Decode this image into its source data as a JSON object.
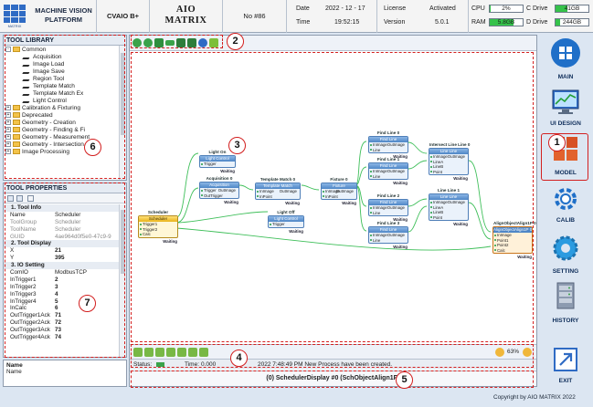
{
  "header": {
    "logo_text": "MATRIX",
    "platform": [
      "MACHINE VISION",
      "PLATFORM"
    ],
    "device": "CVAIO B+",
    "brand": [
      "AIO",
      "MATRIX"
    ],
    "number": "No #86",
    "date_label": "Date",
    "date_value": "2022 - 12 - 17",
    "time_label": "Time",
    "time_value": "19:52:15",
    "license_label": "License",
    "license_value": "Activated",
    "version_label": "Version",
    "version_value": "5.0.1",
    "cpu_label": "CPU",
    "cpu_value": "2%",
    "cpu_fraction": 0.02,
    "ram_label": "RAM",
    "ram_value": "5.8GB",
    "ram_fraction": 0.72,
    "c_drive_label": "C Drive",
    "c_drive_value": "41GB",
    "c_drive_fraction": 0.35,
    "d_drive_label": "D Drive",
    "d_drive_value": "244GB",
    "d_drive_fraction": 0.15
  },
  "tool_library": {
    "title": "TOOL LIBRARY",
    "items": [
      {
        "label": "Common",
        "type": "folder",
        "expanded": true,
        "level": 0
      },
      {
        "label": "Acquisition",
        "type": "tool",
        "level": 1
      },
      {
        "label": "Image Load",
        "type": "tool",
        "level": 1
      },
      {
        "label": "Image Save",
        "type": "tool",
        "level": 1
      },
      {
        "label": "Region Tool",
        "type": "tool",
        "level": 1
      },
      {
        "label": "Template Match",
        "type": "tool",
        "level": 1
      },
      {
        "label": "Template Match Ex",
        "type": "tool",
        "level": 1
      },
      {
        "label": "Light Control",
        "type": "tool",
        "level": 1
      },
      {
        "label": "Calibration & Fixturing",
        "type": "folder",
        "level": 0
      },
      {
        "label": "Deprecated",
        "type": "folder",
        "level": 0
      },
      {
        "label": "Geometry - Creation",
        "type": "folder",
        "level": 0
      },
      {
        "label": "Geometry - Finding & Fi",
        "type": "folder",
        "level": 0
      },
      {
        "label": "Geometry - Measurement",
        "type": "folder",
        "level": 0
      },
      {
        "label": "Geometry - Intersection",
        "type": "folder",
        "level": 0
      },
      {
        "label": "Image Processing",
        "type": "folder",
        "level": 0
      }
    ]
  },
  "tool_properties": {
    "title": "TOOL PROPERTIES",
    "rows": [
      {
        "cat": true,
        "k": "1. Tool Info"
      },
      {
        "k": "Name",
        "v": "Scheduler"
      },
      {
        "k": "ToolGroup",
        "v": "Scheduler",
        "dim": true
      },
      {
        "k": "ToolName",
        "v": "Scheduler",
        "dim": true
      },
      {
        "k": "GUID",
        "v": "4ae964d0f5e0-47c9-9",
        "dim": true
      },
      {
        "cat": true,
        "k": "2. Tool Display"
      },
      {
        "k": "X",
        "v": "21",
        "bold": true
      },
      {
        "k": "Y",
        "v": "395",
        "bold": true
      },
      {
        "cat": true,
        "k": "3. IO Setting"
      },
      {
        "k": "ComIO",
        "v": "ModbusTCP"
      },
      {
        "k": "InTrigger1",
        "v": "2",
        "bold": true
      },
      {
        "k": "InTrigger2",
        "v": "3",
        "bold": true
      },
      {
        "k": "InTrigger3",
        "v": "4",
        "bold": true
      },
      {
        "k": "InTrigger4",
        "v": "5",
        "bold": true
      },
      {
        "k": "InCalc",
        "v": "6",
        "bold": true
      },
      {
        "k": "OutTrigger1Ack",
        "v": "71",
        "bold": true
      },
      {
        "k": "OutTrigger2Ack",
        "v": "72",
        "bold": true
      },
      {
        "k": "OutTrigger3Ack",
        "v": "73",
        "bold": true
      },
      {
        "k": "OutTrigger4Ack",
        "v": "74",
        "bold": true
      }
    ],
    "desc_title": "Name",
    "desc_text": "Name"
  },
  "canvas": {
    "status_label": "Status:",
    "time_label": "Time:",
    "time_value": "0.000",
    "message": "2022 7:48:49 PM New Process have been created.",
    "zoom": "63%",
    "display_bar": "(0) SchedulerDisplay #0 (SchObjectAlign1P)"
  },
  "nodes": {
    "scheduler": {
      "title": "Scheduler",
      "bar": "Scheduler",
      "rows": [
        "Trigger1",
        "Trigger2",
        "Calc"
      ],
      "status": "Waiting"
    },
    "light_on": {
      "title": "Light On",
      "bar": "Light Control",
      "rows": [
        "Trigger"
      ],
      "status": "Waiting"
    },
    "acq": {
      "title": "Acquisition 0",
      "bar": "Acquisition",
      "rows": [
        "Trigger|OutImage",
        "OutTrigger"
      ],
      "status": "Waiting"
    },
    "tmatch": {
      "title": "Template Match 0",
      "bar": "Template Match",
      "rows": [
        "InImage|OutImage",
        "InPoint"
      ],
      "status": "Waiting"
    },
    "fixture": {
      "title": "Fixture 0",
      "bar": "Fixture",
      "rows": [
        "InImage|OutImage",
        "InPoint"
      ],
      "status": "Waiting"
    },
    "light_off": {
      "title": "Light Off",
      "bar": "Light Control",
      "rows": [
        "Trigger"
      ],
      "status": "Waiting"
    },
    "fl0": {
      "title": "Find Line 0",
      "bar": "Find Line",
      "rows": [
        "InImage|OutImage",
        "Line"
      ],
      "status": "Waiting"
    },
    "fl1": {
      "title": "Find Line 1",
      "bar": "Find Line",
      "rows": [
        "InImage|OutImage",
        "Line"
      ],
      "status": "Waiting"
    },
    "fl2": {
      "title": "Find Line 2",
      "bar": "Find Line",
      "rows": [
        "InImage|OutImage",
        "Line"
      ],
      "status": "Waiting"
    },
    "fl3": {
      "title": "Find Line 3",
      "bar": "Find Line",
      "rows": [
        "InImage|OutImage",
        "Line"
      ],
      "status": "Waiting"
    },
    "ill0": {
      "title": "Intersect Line Line 0",
      "bar": "Line Line",
      "rows": [
        "InImage|OutImage",
        "LineA",
        "LineB",
        "Point"
      ],
      "status": "Waiting"
    },
    "ill1": {
      "title": "Line Line 1",
      "bar": "Line Line",
      "rows": [
        "InImage|OutImage",
        "LineA",
        "LineB",
        "Point"
      ],
      "status": "Waiting"
    },
    "align": {
      "title": "AlignObjectAlign1P 0",
      "bar": "AlignObjectAlign1P 0",
      "rows": [
        "InImage",
        "Point1",
        "Point2",
        "Calc"
      ],
      "status": "Waiting"
    }
  },
  "sidebar": [
    {
      "label": "MAIN",
      "icon": "windows-tiles-icon"
    },
    {
      "label": "UI DESIGN",
      "icon": "monitor-chart-icon"
    },
    {
      "label": "MODEL",
      "icon": "model-blocks-icon"
    },
    {
      "label": "CALIB",
      "icon": "calibration-gear-icon"
    },
    {
      "label": "SETTING",
      "icon": "settings-gear-icon"
    },
    {
      "label": "HISTORY",
      "icon": "server-history-icon"
    },
    {
      "label": "EXIT",
      "icon": "exit-icon"
    }
  ],
  "annotations": [
    "1",
    "2",
    "3",
    "4",
    "5",
    "6",
    "7"
  ],
  "footer": "Copyright by AIO MATRIX 2022",
  "colors": {
    "accent": "#2f6bc4",
    "panel_title": "#e5ebf3",
    "highlight": "#d21d1d",
    "connector": "#3fbf5a"
  }
}
